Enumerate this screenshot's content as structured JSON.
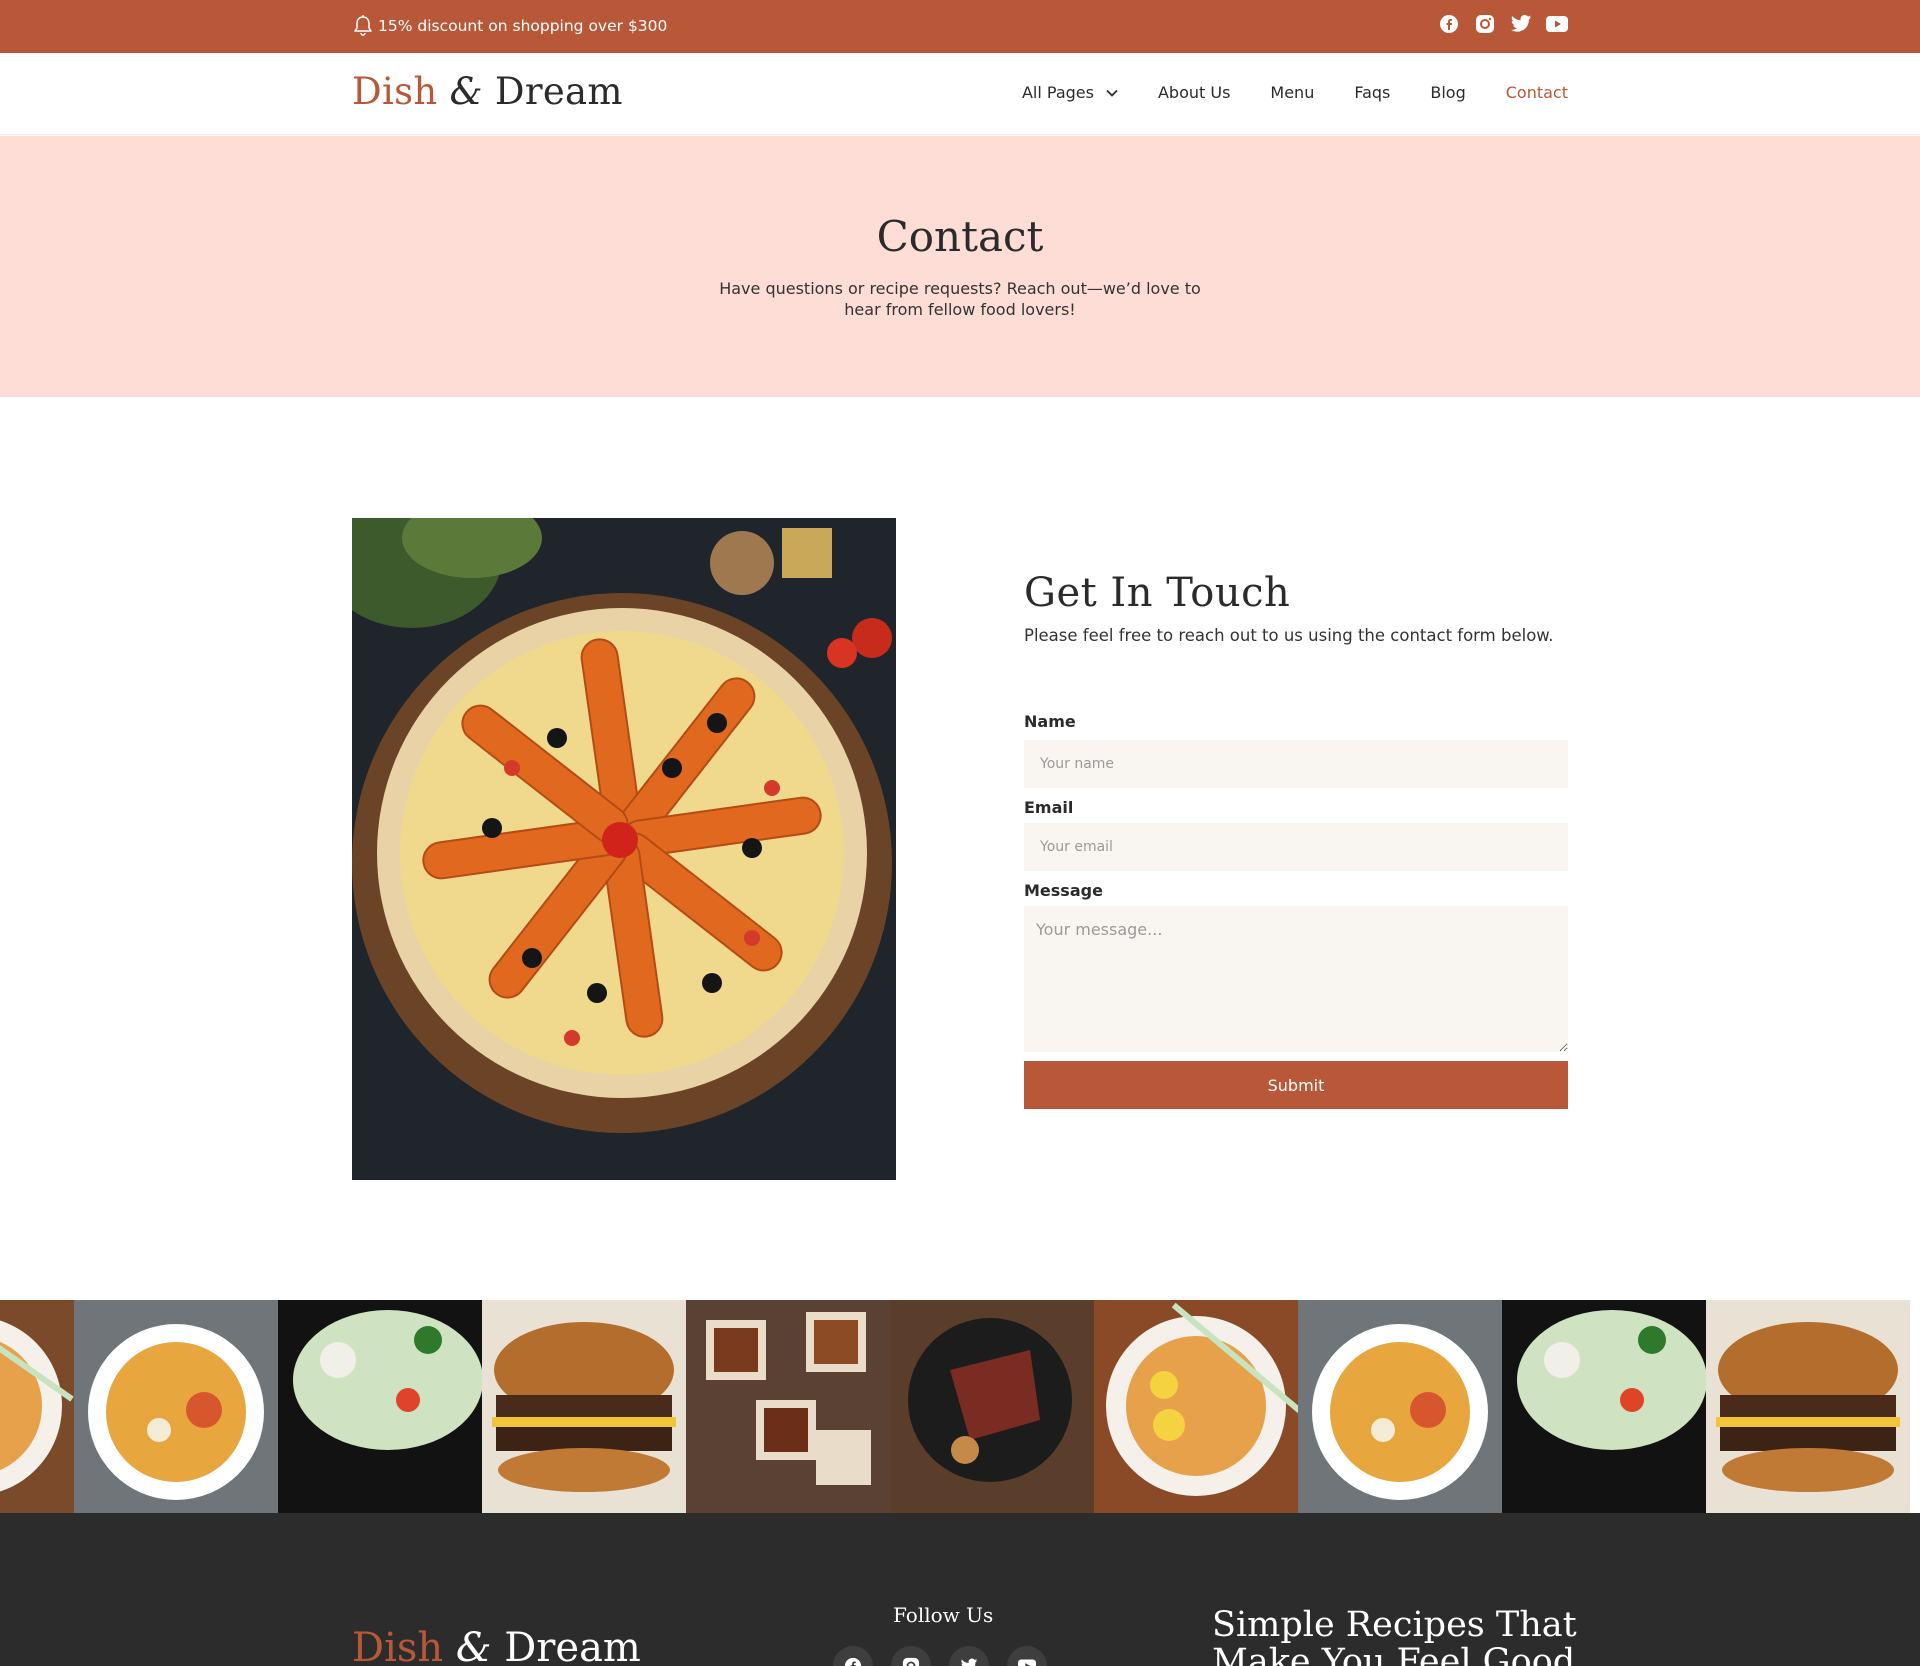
{
  "topbar": {
    "promo": "15% discount on shopping over $300",
    "socials": [
      "facebook-icon",
      "instagram-icon",
      "twitter-icon",
      "youtube-icon"
    ]
  },
  "brand": {
    "part1": "Dish",
    "amp": "&",
    "part2": "Dream"
  },
  "nav": {
    "all_pages": "All Pages",
    "about": "About Us",
    "menu": "Menu",
    "faqs": "Faqs",
    "blog": "Blog",
    "contact": "Contact",
    "active": "Contact"
  },
  "hero": {
    "title": "Contact",
    "subtitle": "Have questions or recipe requests? Reach out—we’d love to hear from fellow food lovers!"
  },
  "contact": {
    "title": "Get In Touch",
    "subtitle": "Please feel free to reach out to us using the contact form below.",
    "name_label": "Name",
    "name_placeholder": "Your name",
    "email_label": "Email",
    "email_placeholder": "Your email",
    "message_label": "Message",
    "message_placeholder": "Your message...",
    "submit": "Submit"
  },
  "gallery": [
    "ramen",
    "noodle-soup",
    "salad",
    "burger",
    "snack-platter",
    "steak",
    "ramen",
    "noodle-soup",
    "salad",
    "burger"
  ],
  "footer": {
    "follow_title": "Follow Us",
    "tagline": "Simple Recipes That Make You Feel Good"
  },
  "colors": {
    "accent": "#b95838",
    "hero_bg": "#fdddd5",
    "footer_bg": "#2c2c2c",
    "input_bg": "#f9f6f1"
  }
}
